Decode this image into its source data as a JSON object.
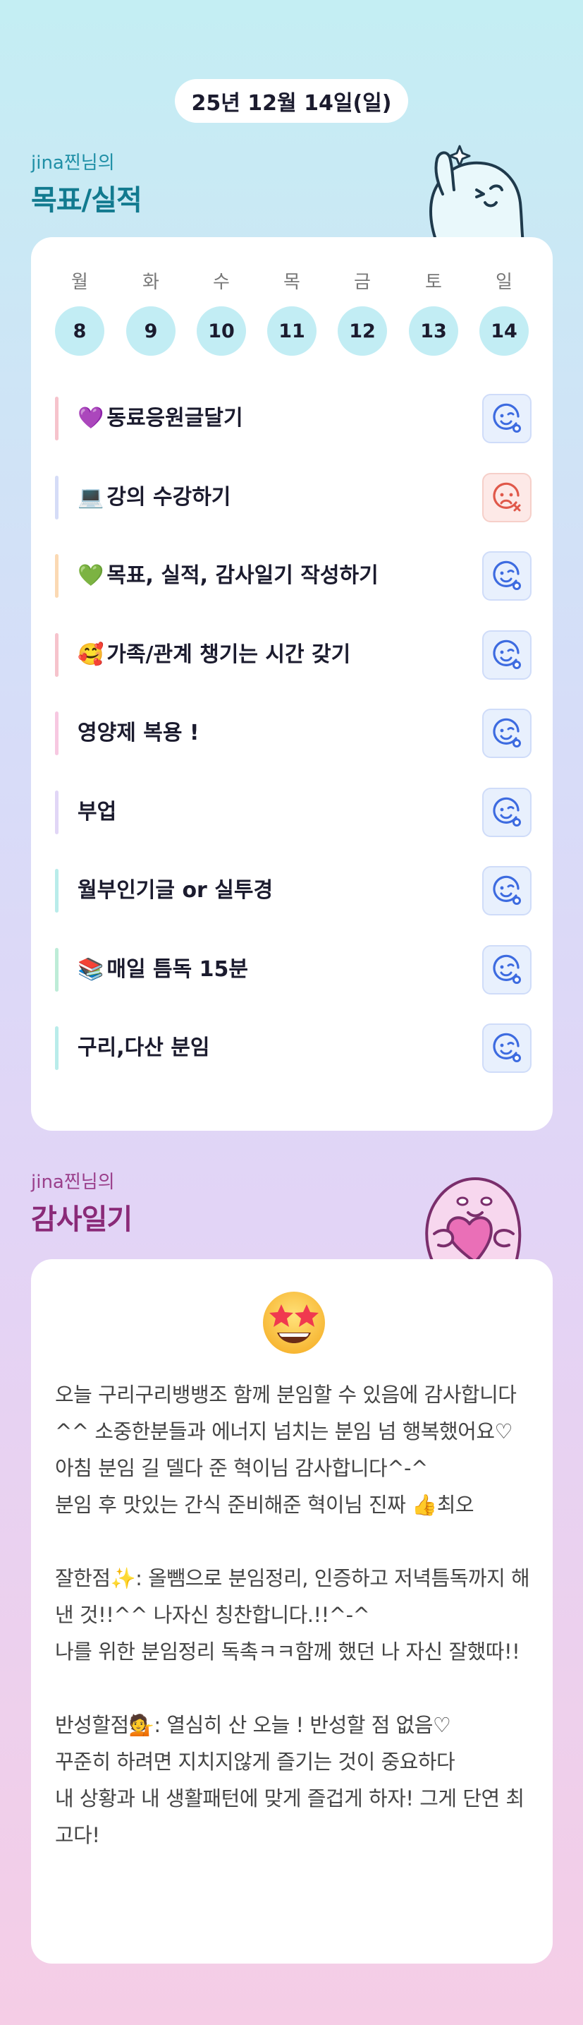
{
  "date": "25년 12월 14일(일)",
  "goals_section": {
    "owner": "jina찐님의",
    "title": "목표/실적"
  },
  "week": [
    {
      "day": "월",
      "date": "8"
    },
    {
      "day": "화",
      "date": "9"
    },
    {
      "day": "수",
      "date": "10"
    },
    {
      "day": "목",
      "date": "11"
    },
    {
      "day": "금",
      "date": "12"
    },
    {
      "day": "토",
      "date": "13"
    },
    {
      "day": "일",
      "date": "14"
    }
  ],
  "goals": [
    {
      "emoji": "💜",
      "text": "동료응원글달기",
      "bar_color": "#f6c3cc",
      "status": "done"
    },
    {
      "emoji": "💻",
      "text": "강의 수강하기",
      "bar_color": "#d5dcf7",
      "status": "failed"
    },
    {
      "emoji": "💚",
      "text": "목표, 실적, 감사일기 작성하기",
      "bar_color": "#fbd9b3",
      "status": "done"
    },
    {
      "emoji": "🥰",
      "text": "가족/관계 챙기는 시간 갖기",
      "bar_color": "#f6c3cc",
      "status": "done"
    },
    {
      "emoji": "",
      "text": "영양제 복용 !",
      "bar_color": "#f7c8e1",
      "status": "done"
    },
    {
      "emoji": "",
      "text": "부업",
      "bar_color": "#e1d6f6",
      "status": "done"
    },
    {
      "emoji": "",
      "text": "월부인기글 or 실투경",
      "bar_color": "#b9ecea",
      "status": "done"
    },
    {
      "emoji": "📚",
      "text": "매일 틈독 15분",
      "bar_color": "#bdecd7",
      "status": "done"
    },
    {
      "emoji": "",
      "text": "구리,다산 분임",
      "bar_color": "#b9ecea",
      "status": "done"
    }
  ],
  "thanks_section": {
    "owner": "jina찐님의",
    "title": "감사일기"
  },
  "thanks": {
    "mood_icon": "star-struck-face-icon",
    "body": "오늘 구리구리뱅뱅조 함께 분임할 수 있음에 감사합니다^^ 소중한분들과 에너지 넘치는 분임 넘 행복했어요♡ 아침 분임 길 델다 준 혁이님 감사합니다^-^\n분임 후 맛있는 간식 준비해준 혁이님 진짜 👍최오\n\n잘한점✨: 올뺌으로 분임정리, 인증하고 저녁틈독까지 해낸 것!!^^ 나자신 칭찬합니다.!!^-^\n나를 위한 분임정리 독촉ㅋㅋ함께 했던 나 자신 잘했따!!\n\n반성할점💁: 열심히 산 오늘 ! 반성할 점 없음♡\n꾸준히 하려면 지치지않게 즐기는 것이 중요하다\n내 상황과 내 생활패턴에 맞게 즐겁게 하자! 그게 단연 최고다!"
  },
  "colors": {
    "ok": "#3d6be0",
    "fail": "#e0584a",
    "accent": "#127a8f",
    "thanks_accent": "#8a2a78"
  }
}
